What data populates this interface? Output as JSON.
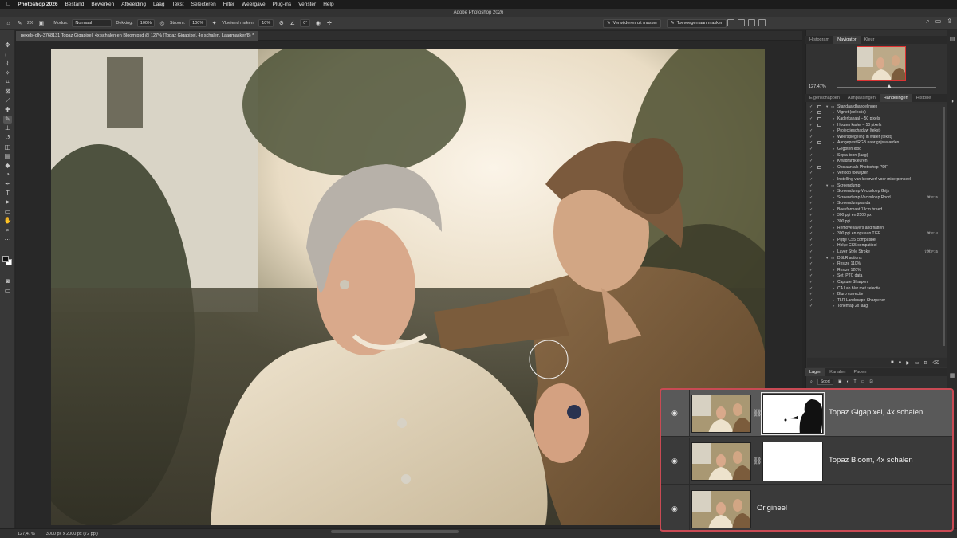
{
  "menubar": {
    "app": "Photoshop 2026",
    "items": [
      "Bestand",
      "Bewerken",
      "Afbeelding",
      "Laag",
      "Tekst",
      "Selecteren",
      "Filter",
      "Weergave",
      "Plug-ins",
      "Venster",
      "Help"
    ]
  },
  "window_title": "Adobe Photoshop 2026",
  "options": {
    "modus_label": "Modus:",
    "modus_value": "Normaal",
    "dekking_label": "Dekking:",
    "dekking_value": "100%",
    "stroom_label": "Stroom:",
    "stroom_value": "100%",
    "vloeiend_label": "Vloeiend maken:",
    "vloeiend_value": "10%",
    "angle_value": "0°",
    "brush_size": "200",
    "mask_remove": "Verwijderen uit masker",
    "mask_add": "Toevoegen aan masker"
  },
  "document_tab": "pexels-olly-3768131 Topaz Gigapixel, 4x schalen en Bloom.psd @ 127% (Topaz Gigapixel, 4x schalen, Laagmasker/8) *",
  "status": {
    "zoom": "127,47%",
    "dimensions": "3000 px x 2000 px (72 ppi)"
  },
  "panels": {
    "top_tabs": [
      "Histogram",
      "Navigator",
      "Kleur"
    ],
    "top_active": 1,
    "navigator_zoom": "127,47%",
    "mid_tabs": [
      "Eigenschappen",
      "Aanpassingen",
      "Handelingen",
      "Historie"
    ],
    "mid_active": 2,
    "layers_tabs": [
      "Lagen",
      "Kanalen",
      "Paden"
    ],
    "layers_active": 0,
    "layers_filter": "Soort"
  },
  "actions": [
    {
      "label": "Standaardhandelingen",
      "level": 0,
      "folder": true,
      "dialog": true
    },
    {
      "label": "Vignet (selectie)",
      "level": 1,
      "dialog": true
    },
    {
      "label": "Kaderkanaal – 50 pixels",
      "level": 1,
      "dialog": true
    },
    {
      "label": "Houten kader – 50 pixels",
      "level": 1,
      "dialog": true
    },
    {
      "label": "Projectieschaduw (tekst)",
      "level": 1
    },
    {
      "label": "Weerspiegeling in water (tekst)",
      "level": 1
    },
    {
      "label": "Aangepast RGB naar grijswaarden",
      "level": 1,
      "dialog": true
    },
    {
      "label": "Gegoten lood",
      "level": 1
    },
    {
      "label": "Sepia-toon (laag)",
      "level": 1
    },
    {
      "label": "Kwadrantkleuren",
      "level": 1
    },
    {
      "label": "Opslaan als Photoshop PDF",
      "level": 1,
      "dialog": true
    },
    {
      "label": "Verloop toewijzen",
      "level": 1
    },
    {
      "label": "Instelling van kleurverf voor mixerpenseel",
      "level": 1
    },
    {
      "label": "Screendump",
      "level": 0,
      "folder": true
    },
    {
      "label": "Screendump Vectorloep Grijs",
      "level": 1
    },
    {
      "label": "Screendump Vectorloep Rood",
      "level": 1,
      "key": "⌘ F15"
    },
    {
      "label": "Screendumpranda",
      "level": 1
    },
    {
      "label": "Boekformaat 13cm breed",
      "level": 1
    },
    {
      "label": "300 ppi en 2500 px",
      "level": 1
    },
    {
      "label": "300 ppi",
      "level": 1
    },
    {
      "label": "Remove layers and flatten",
      "level": 1
    },
    {
      "label": "300 ppi en opslaan TIFF",
      "level": 1,
      "key": "⌘ F14"
    },
    {
      "label": "Pijltje CS5 compatibel",
      "level": 1
    },
    {
      "label": "Hokje CS5 compatibel",
      "level": 1
    },
    {
      "label": "Layer Style Stroke",
      "level": 1,
      "key": "⇧⌘ F15"
    },
    {
      "label": "DSLR actions",
      "level": 0,
      "folder": true
    },
    {
      "label": "Resize 110%",
      "level": 1
    },
    {
      "label": "Resize 120%",
      "level": 1
    },
    {
      "label": "Set IPTC data",
      "level": 1
    },
    {
      "label": "Capture Sharpen",
      "level": 1
    },
    {
      "label": "CA Lab blur met selectie",
      "level": 1
    },
    {
      "label": "Blurb correctie",
      "level": 1
    },
    {
      "label": "TLR Landscape Sharpener",
      "level": 1
    },
    {
      "label": "Tonemap 2x laag",
      "level": 1
    }
  ],
  "layers": [
    {
      "name": "Topaz Gigapixel, 4x schalen",
      "active": true,
      "mask": "figure"
    },
    {
      "name": "Topaz Bloom, 4x schalen",
      "active": false,
      "mask": "white"
    },
    {
      "name": "Origineel",
      "active": false,
      "mask": "none"
    }
  ],
  "colors": {
    "callout_border": "#c94a54",
    "active_layer_bg": "#595959",
    "panel_bg": "#323232"
  }
}
